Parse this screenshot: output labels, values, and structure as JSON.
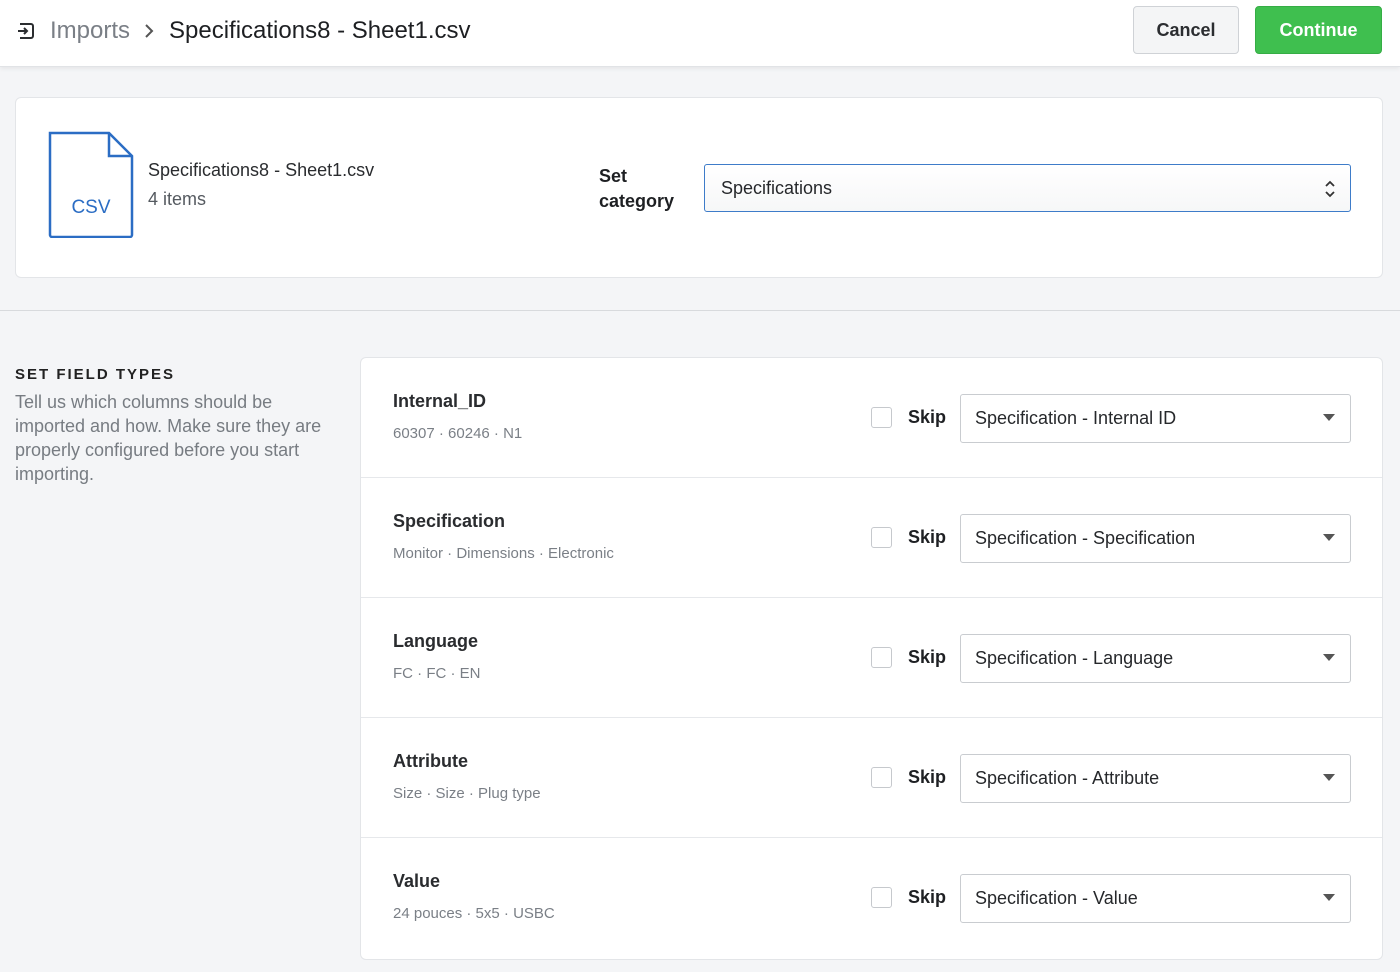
{
  "header": {
    "breadcrumb_root": "Imports",
    "breadcrumb_current": "Specifications8 - Sheet1.csv",
    "cancel_label": "Cancel",
    "continue_label": "Continue"
  },
  "file": {
    "icon_text": "CSV",
    "name": "Specifications8 - Sheet1.csv",
    "items": "4 items",
    "category_label": "Set category",
    "category_value": "Specifications"
  },
  "field_types": {
    "title": "SET FIELD TYPES",
    "description": "Tell us which columns should be imported and how. Make sure they are properly configured before you start importing.",
    "skip_label": "Skip",
    "rows": [
      {
        "name": "Internal_ID",
        "sample": "60307 · 60246 · N1",
        "type": "Specification - Internal ID",
        "skip": false
      },
      {
        "name": "Specification",
        "sample": "Monitor · Dimensions · Electronic",
        "type": "Specification - Specification",
        "skip": false
      },
      {
        "name": "Language",
        "sample": "FC · FC · EN",
        "type": "Specification - Language",
        "skip": false
      },
      {
        "name": "Attribute",
        "sample": "Size · Size · Plug type",
        "type": "Specification - Attribute",
        "skip": false
      },
      {
        "name": "Value",
        "sample": "24 pouces · 5x5 · USBC",
        "type": "Specification - Value",
        "skip": false
      }
    ]
  },
  "colors": {
    "accent_green": "#3fbf4f",
    "accent_blue": "#3e7cc9"
  }
}
